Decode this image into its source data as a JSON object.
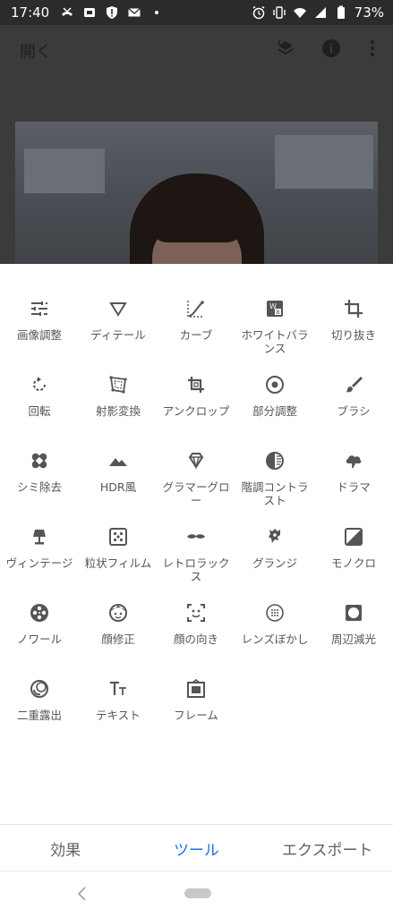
{
  "status_bar": {
    "time": "17:40",
    "battery": "73%",
    "left_icons": [
      "missed-call-icon",
      "sim-icon",
      "alert-shield-icon",
      "mail-icon",
      "dot-icon"
    ],
    "right_icons": [
      "alarm-icon",
      "vibrate-icon",
      "wifi-icon",
      "signal-icon",
      "battery-icon"
    ]
  },
  "editor": {
    "open_label": "開く",
    "top_icons": [
      "stacks-icon",
      "info-icon",
      "more-vert-icon"
    ]
  },
  "tools": [
    {
      "label": "画像調整",
      "icon": "tune-icon"
    },
    {
      "label": "ディテール",
      "icon": "triangle-details-icon"
    },
    {
      "label": "カーブ",
      "icon": "curve-icon"
    },
    {
      "label": "ホワイトバランス",
      "icon": "white-balance-icon"
    },
    {
      "label": "切り抜き",
      "icon": "crop-icon"
    },
    {
      "label": "回転",
      "icon": "rotate-icon"
    },
    {
      "label": "射影変換",
      "icon": "perspective-icon"
    },
    {
      "label": "アンクロップ",
      "icon": "expand-icon"
    },
    {
      "label": "部分調整",
      "icon": "selective-icon"
    },
    {
      "label": "ブラシ",
      "icon": "brush-icon"
    },
    {
      "label": "シミ除去",
      "icon": "healing-icon"
    },
    {
      "label": "HDR風",
      "icon": "hdr-mountain-icon"
    },
    {
      "label": "グラマーグロー",
      "icon": "diamond-icon"
    },
    {
      "label": "階調コントラスト",
      "icon": "tonal-contrast-icon"
    },
    {
      "label": "ドラマ",
      "icon": "drama-cloud-icon"
    },
    {
      "label": "ヴィンテージ",
      "icon": "vintage-lamp-icon"
    },
    {
      "label": "粒状フィルム",
      "icon": "grainy-film-icon"
    },
    {
      "label": "レトロラックス",
      "icon": "mustache-icon"
    },
    {
      "label": "グランジ",
      "icon": "grunge-icon"
    },
    {
      "label": "モノクロ",
      "icon": "black-white-icon"
    },
    {
      "label": "ノワール",
      "icon": "film-reel-icon"
    },
    {
      "label": "顔修正",
      "icon": "face-retouch-icon"
    },
    {
      "label": "顔の向き",
      "icon": "face-pose-icon"
    },
    {
      "label": "レンズぼかし",
      "icon": "lens-blur-icon"
    },
    {
      "label": "周辺減光",
      "icon": "vignette-icon"
    },
    {
      "label": "二重露出",
      "icon": "double-exposure-icon"
    },
    {
      "label": "テキスト",
      "icon": "text-icon"
    },
    {
      "label": "フレーム",
      "icon": "frame-icon"
    }
  ],
  "tabs": [
    {
      "label": "効果",
      "active": false
    },
    {
      "label": "ツール",
      "active": true
    },
    {
      "label": "エクスポート",
      "active": false
    }
  ],
  "colors": {
    "accent": "#1a73e8",
    "icon": "#555555",
    "text": "#555555",
    "dim_overlay": "#3b3b3b"
  }
}
